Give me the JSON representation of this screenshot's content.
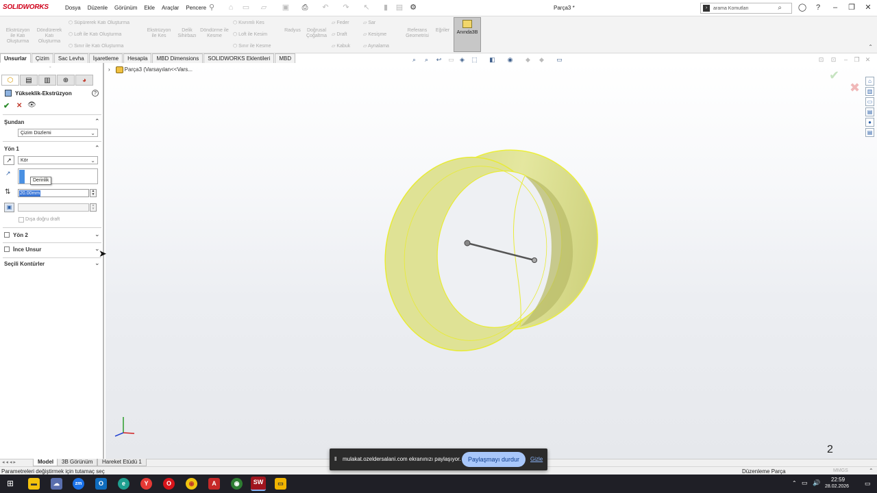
{
  "app": {
    "logo": "SOLIDWORKS",
    "doc_title": "Parça3 *"
  },
  "menu": [
    "Dosya",
    "Düzenle",
    "Görünüm",
    "Ekle",
    "Araçlar",
    "Pencere"
  ],
  "search": {
    "placeholder": "arama Komutları"
  },
  "ribbon": {
    "extrude_boss": "Ekstrüzyon ile Katı Oluşturma",
    "revolve_boss": "Döndürerek Katı Oluşturma",
    "swept_boss": "Süpürerek Katı Oluşturma",
    "loft_boss": "Loft ile Katı Oluşturma",
    "boundary_boss": "Sınır ile Katı Oluşturma",
    "extrude_cut": "Ekstrüzyon ile Kes",
    "hole_wizard": "Delik Sihirbazı",
    "revolve_cut": "Döndürme ile Kesme",
    "swept_cut": "Kıvrımlı Kes",
    "loft_cut": "Loft ile Kesim",
    "boundary_cut": "Sınır ile Kesme",
    "fillet": "Radyus",
    "linear_pattern": "Doğrusal Çoğaltma",
    "rib": "Feder",
    "draft": "Draft",
    "shell": "Kabuk",
    "wrap": "Sar",
    "intersect": "Kesişme",
    "mirror": "Aynalama",
    "ref_geometry": "Referans Geometrisi",
    "curves": "Eğriler",
    "instant3d": "Anında3B"
  },
  "tabs": [
    "Unsurlar",
    "Çizim",
    "Sac Levha",
    "İşaretleme",
    "Hesapla",
    "MBD Dimensions",
    "SOLIDWORKS Eklentileri",
    "MBD"
  ],
  "panel": {
    "title": "Yükseklik-Ekstrüzyon",
    "help": "?",
    "from_label": "Şundan",
    "from_value": "Çizim Düzlemi",
    "dir1_label": "Yön 1",
    "end_condition": "Kör",
    "tooltip": "Derinlik",
    "depth_value": "20.00mm",
    "draft_outward": "Dışa doğru draft",
    "dir2_label": "Yön 2",
    "thin_label": "İnce Unsur",
    "contours_label": "Seçili Kontürler"
  },
  "tree": {
    "root": "Parça3  (Varsayılan<<Vars..."
  },
  "model_tabs": [
    "Model",
    "3B Görünüm",
    "Hareket Etüdü 1"
  ],
  "status": {
    "left": "Parametreleri değiştirmek için tutamaç seç",
    "mode": "Düzenleme Parça",
    "units": "MMGS"
  },
  "viewport_number": "2",
  "share_bar": {
    "message": "mulakat.ozeldersalani.com ekranınızı paylaşıyor.",
    "stop": "Paylaşmayı durdur",
    "hide": "Gizle"
  },
  "clock": {
    "time": "22:59",
    "date": "28.02.2026"
  },
  "colors": {
    "part_fill": "#e3e69a",
    "edge": "#ecef3a",
    "accent": "#d0021b",
    "selection": "#3875d7"
  }
}
